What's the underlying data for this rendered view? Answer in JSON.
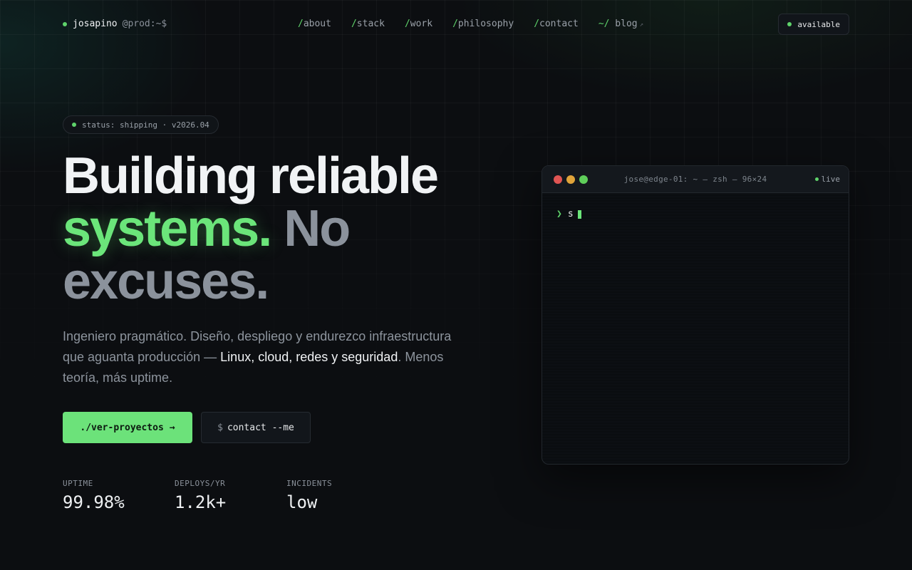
{
  "nav": {
    "brand": {
      "name": "josapino",
      "host": "@prod:~$"
    },
    "links": [
      {
        "prefix": "/",
        "label": "about"
      },
      {
        "prefix": "/",
        "label": "stack"
      },
      {
        "prefix": "/",
        "label": "work"
      },
      {
        "prefix": "/",
        "label": "philosophy"
      },
      {
        "prefix": "/",
        "label": "contact"
      },
      {
        "prefix": "~/",
        "label": "blog",
        "external_icon": "external-link-icon"
      }
    ],
    "status_badge": "available"
  },
  "hero": {
    "status_pill": "status: shipping · v2026.04",
    "headline": {
      "line1": "Building reliable",
      "highlight": "systems.",
      "muted": "No excuses."
    },
    "lead": {
      "before": "Ingeniero pragmático. Diseño, despliego y endurezco infraestructura que aguanta producción — ",
      "highlight": "Linux, cloud, redes y seguridad",
      "after": ". Menos teoría, más uptime."
    },
    "primary_cta": {
      "label": "./ver-proyectos",
      "arrow": "→"
    },
    "secondary_cta": {
      "prefix": "$",
      "label": "contact --me"
    },
    "stats": [
      {
        "label": "UPTIME",
        "value": "99.98%"
      },
      {
        "label": "DEPLOYS/YR",
        "value": "1.2k+"
      },
      {
        "label": "INCIDENTS",
        "value": "low"
      }
    ]
  },
  "terminal": {
    "title": "jose@edge-01: ~ — zsh — 96×24",
    "live_label": "live",
    "prompt": "❯",
    "typed": "s"
  },
  "colors": {
    "accent": "#6be57a",
    "background": "#0c0e11",
    "muted_text": "#8b929c"
  }
}
